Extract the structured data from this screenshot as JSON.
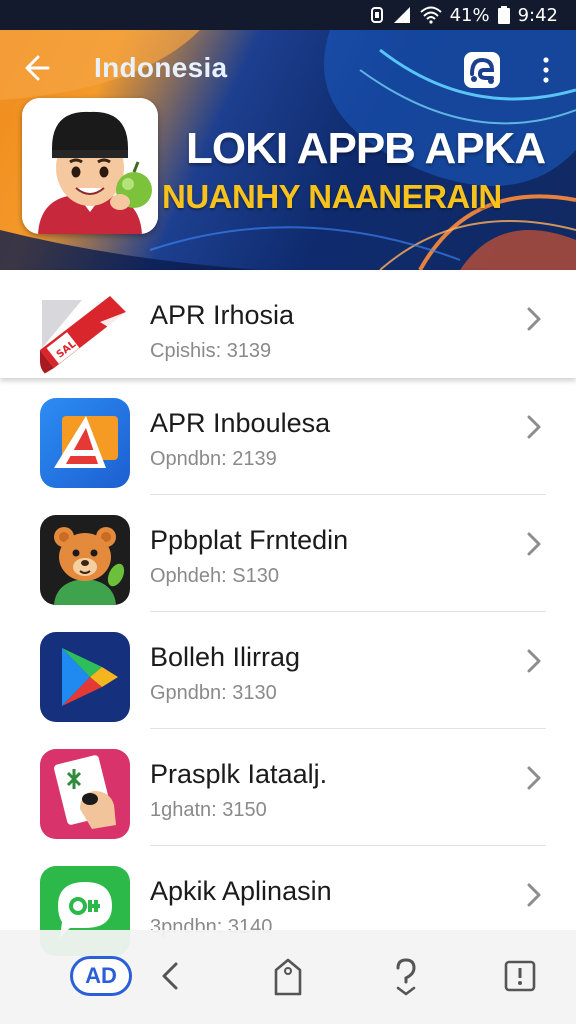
{
  "status_bar": {
    "battery_text": "41%",
    "time": "9:42"
  },
  "header": {
    "title": "Indonesia",
    "banner_title": "LOKI APPB APKA",
    "banner_subtitle": "NUANHY NAANERAIN"
  },
  "apps": [
    {
      "name": "APR Irhosia",
      "meta": "Cpishis: 3139",
      "icon": "red-bandage-icon"
    },
    {
      "name": "APR Inboulesa",
      "meta": "Opndbn: 2139",
      "icon": "blue-triangle-app-icon"
    },
    {
      "name": "Ppbplat Frntedin",
      "meta": "Ophdeh: S130",
      "icon": "bear-mascot-icon"
    },
    {
      "name": "Bolleh Ilirrag",
      "meta": "Gpndbn: 3130",
      "icon": "play-store-icon"
    },
    {
      "name": "Prasplk Iataalj.",
      "meta": "1ghatn: 3150",
      "icon": "pink-card-hand-icon"
    },
    {
      "name": "Apkik Aplinasin",
      "meta": "3pndbn: 3140",
      "icon": "green-chat-icon"
    }
  ],
  "bottom_nav": {
    "ad_label": "AD"
  },
  "colors": {
    "accent_orange": "#f08a1c",
    "header_navy": "#0f2b6e",
    "subtitle_yellow": "#f7c21b",
    "ad_blue": "#2b5fd9"
  }
}
